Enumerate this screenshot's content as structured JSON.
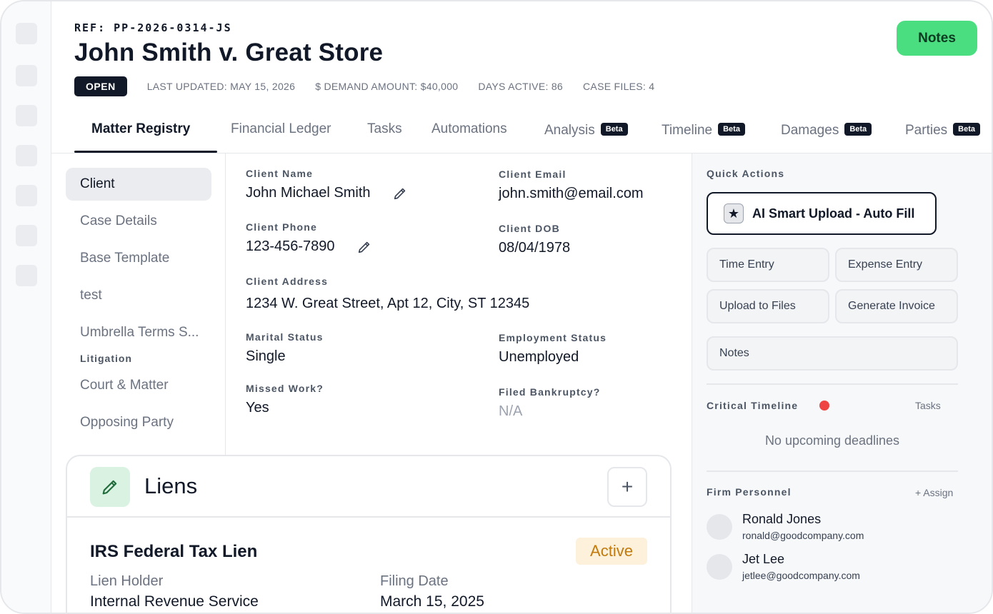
{
  "header": {
    "ref": "REF: PP-2026-0314-JS",
    "title": "John Smith v. Great Store",
    "notes_button": "Notes",
    "status": "OPEN",
    "last_updated": "LAST UPDATED: MAY 15, 2026",
    "demand_amount": "$ DEMAND AMOUNT: $40,000",
    "days_active": "DAYS ACTIVE: 86",
    "case_files": "CASE FILES: 4"
  },
  "tabs": [
    {
      "label": "Matter Registry",
      "active": true
    },
    {
      "label": "Financial Ledger"
    },
    {
      "label": "Tasks"
    },
    {
      "label": "Automations"
    },
    {
      "label": "Analysis",
      "badge": "Beta"
    },
    {
      "label": "Timeline",
      "badge": "Beta"
    },
    {
      "label": "Damages",
      "badge": "Beta"
    },
    {
      "label": "Parties",
      "badge": "Beta"
    }
  ],
  "sidebar": {
    "items": [
      "Client",
      "Case Details",
      "Base Template",
      "test",
      "Umbrella Terms S..."
    ],
    "group_label": "Litigation",
    "group_items": [
      "Court & Matter",
      "Opposing Party"
    ]
  },
  "client": {
    "name_label": "Client Name",
    "name": "John Michael Smith",
    "email_label": "Client Email",
    "email": "john.smith@email.com",
    "phone_label": "Client Phone",
    "phone": "123-456-7890",
    "dob_label": "Client DOB",
    "dob": "08/04/1978",
    "address_label": "Client Address",
    "address": "1234 W. Great Street, Apt 12, City, ST 12345",
    "marital_label": "Marital Status",
    "marital": "Single",
    "employment_label": "Employment Status",
    "employment": "Unemployed",
    "missed_work_label": "Missed Work?",
    "missed_work": "Yes",
    "bankruptcy_label": "Filed Bankruptcy?",
    "bankruptcy": "N/A"
  },
  "liens": {
    "title": "Liens",
    "add_label": "+",
    "item": {
      "name": "IRS Federal Tax Lien",
      "status": "Active",
      "holder_label": "Lien Holder",
      "holder": "Internal Revenue Service",
      "filing_label": "Filing Date",
      "filing_date": "March 15, 2025"
    }
  },
  "quick_actions": {
    "label": "Quick Actions",
    "ai_upload": "AI Smart Upload - Auto Fill",
    "ai_icon": "★",
    "time_entry": "Time Entry",
    "expense_entry": "Expense Entry",
    "upload_files": "Upload to Files",
    "generate_invoice": "Generate Invoice",
    "notes": "Notes"
  },
  "timeline": {
    "label": "Critical Timeline",
    "tasks_link": "Tasks",
    "empty": "No upcoming deadlines",
    "dot_color": "#ef4444"
  },
  "personnel": {
    "label": "Firm Personnel",
    "assign": "+ Assign",
    "people": [
      {
        "name": "Ronald Jones",
        "email": "ronald@goodcompany.com"
      },
      {
        "name": "Jet Lee",
        "email": "jetlee@goodcompany.com"
      }
    ]
  },
  "colors": {
    "accent_green": "#4ade80",
    "dark": "#111827",
    "active_badge_bg": "#fdf1dc",
    "active_badge_text": "#c27a0e"
  }
}
